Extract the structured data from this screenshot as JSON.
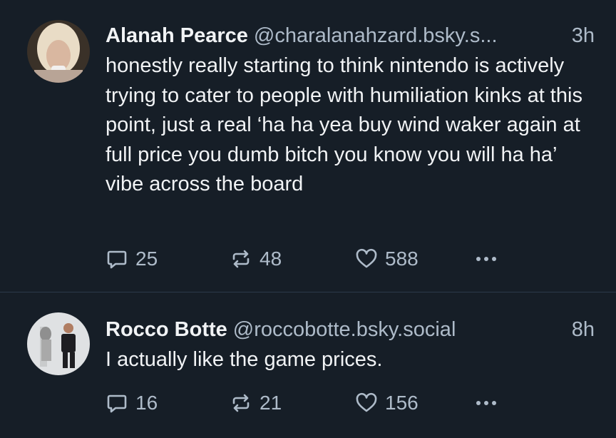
{
  "posts": [
    {
      "author_name": "Alanah Pearce",
      "handle": "@charalanahzard.bsky.s...",
      "time": "3h",
      "text": "honestly really starting to think nintendo is actively trying to cater to people with humiliation kinks at this point, just a real ‘ha ha yea buy wind waker again at full price you dumb bitch you know you will ha ha’ vibe across the board",
      "replies": "25",
      "reposts": "48",
      "likes": "588"
    },
    {
      "author_name": "Rocco Botte",
      "handle": "@roccobotte.bsky.social",
      "time": "8h",
      "text": "I actually like the game prices.",
      "replies": "16",
      "reposts": "21",
      "likes": "156"
    }
  ],
  "icons": {
    "reply": "reply-icon",
    "repost": "repost-icon",
    "like": "heart-icon",
    "more": "more-options-icon"
  },
  "colors": {
    "background": "#161e27",
    "text": "#f1f3f5",
    "muted": "#aebbc9",
    "divider": "#2c3a4a"
  }
}
